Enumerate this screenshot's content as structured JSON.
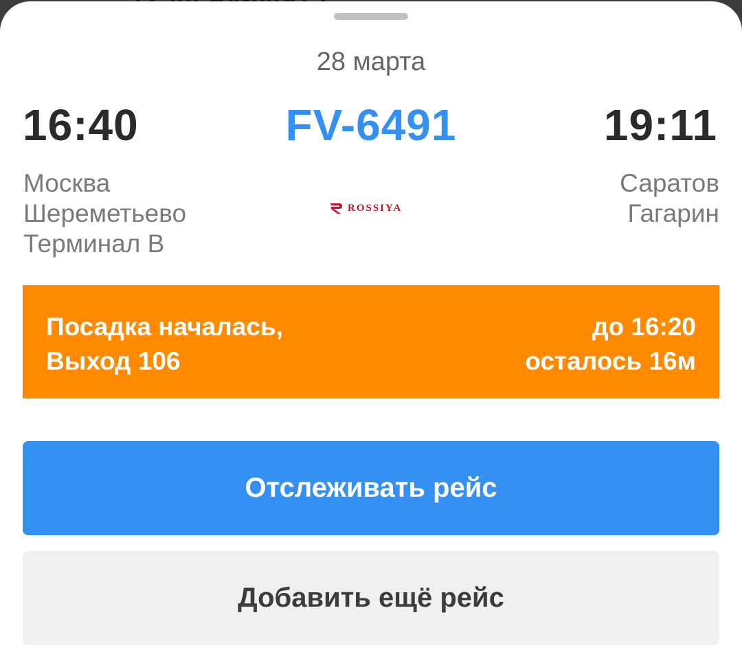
{
  "sheet": {
    "date": "28 марта"
  },
  "flight": {
    "number": "FV-6491",
    "departure": {
      "time": "16:40",
      "city": "Москва",
      "airport": "Шереметьево",
      "terminal": "Терминал B"
    },
    "arrival": {
      "time": "19:11",
      "city": "Саратов",
      "airport": "Гагарин"
    },
    "airline": {
      "logo_text": "ROSSIYA",
      "logo_color": "#c8102e"
    }
  },
  "status": {
    "line1": "Посадка началась,",
    "line2": "Выход 106",
    "until": "до 16:20",
    "remaining": "осталось 16м",
    "color": "#ff8a00"
  },
  "actions": {
    "track_label": "Отслеживать рейс",
    "add_label": "Добавить ещё рейс",
    "accent": "#3590f3"
  }
}
